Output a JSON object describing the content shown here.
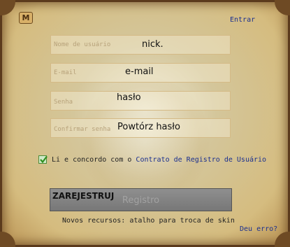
{
  "header": {
    "logo": "M",
    "entrar_link": "Entrar"
  },
  "fields": {
    "username": {
      "placeholder": "Nome de usuário",
      "overlay": "nick."
    },
    "email": {
      "placeholder": "E-mail",
      "overlay": "e-mail"
    },
    "password": {
      "placeholder": "Senha",
      "overlay": "hasło"
    },
    "confirm": {
      "placeholder": "Confirmar senha",
      "overlay": "Powtórz hasło"
    }
  },
  "agreement": {
    "checked": true,
    "text": "Li e concordo com o ",
    "link": "Contrato de Registro de Usuário"
  },
  "register_button": {
    "overlay": "ZAREJESTRUJ",
    "label": "Registro"
  },
  "footer": {
    "news": "Novos recursos: atalho para troca de skin",
    "help_link": "Deu erro?"
  },
  "colors": {
    "link": "#1a2f8f",
    "parchment": "#f1e1af",
    "button": "#7f7f7f"
  }
}
